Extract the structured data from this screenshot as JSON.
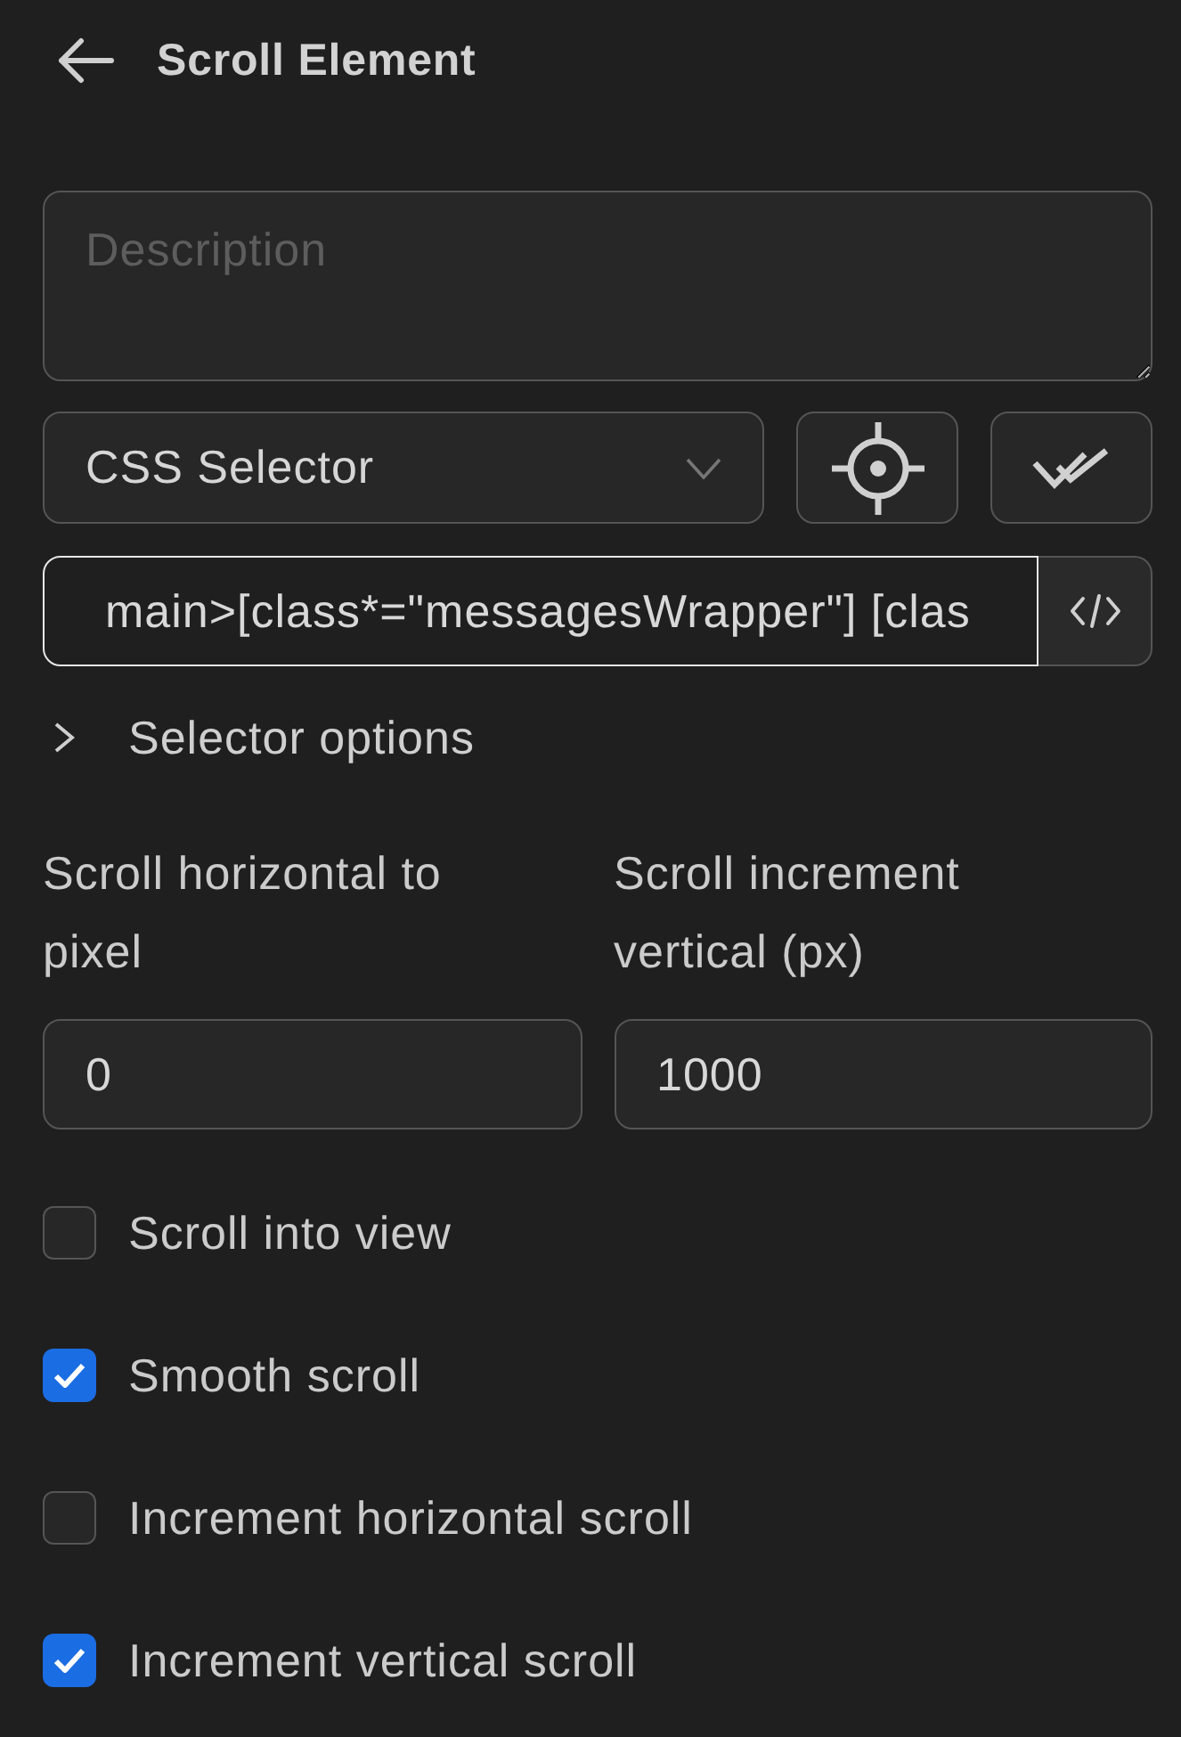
{
  "header": {
    "title": "Scroll Element"
  },
  "description": {
    "placeholder": "Description"
  },
  "selector_type": {
    "value": "CSS Selector"
  },
  "selector": {
    "value": "main>[class*=\"messagesWrapper\"] [clas",
    "focused": true
  },
  "selector_options": {
    "label": "Selector options",
    "expanded": false
  },
  "fields": [
    {
      "label": "Scroll horizontal to pixel",
      "value": "0"
    },
    {
      "label": "Scroll increment vertical (px)",
      "value": "1000"
    }
  ],
  "checkboxes": [
    {
      "label": "Scroll into view",
      "checked": false
    },
    {
      "label": "Smooth scroll",
      "checked": true
    },
    {
      "label": "Increment horizontal scroll",
      "checked": false
    },
    {
      "label": "Increment vertical scroll",
      "checked": true
    }
  ]
}
